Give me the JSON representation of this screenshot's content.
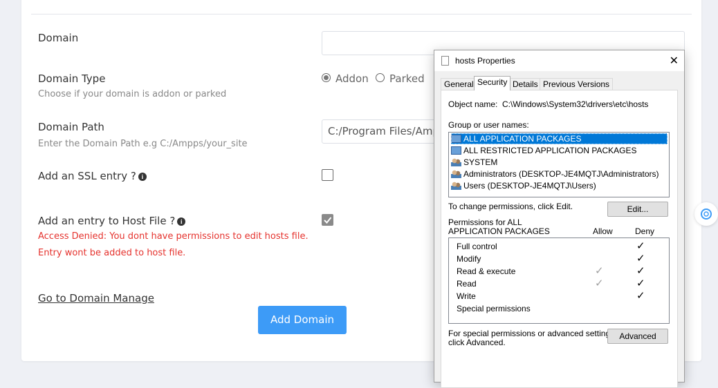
{
  "form": {
    "domain_label": "Domain",
    "domain_value": "",
    "domain_type_label": "Domain Type",
    "domain_type_hint": "Choose if your domain is addon or parked",
    "type_options": [
      "Addon",
      "Parked"
    ],
    "domain_path_label": "Domain Path",
    "domain_path_hint": "Enter the Domain Path e.g C:/Ampps/your_site",
    "domain_path_value": "C:/Program Files/Amp",
    "ssl_label": "Add an SSL entry ?",
    "hosts_label": "Add an entry to Host File ?",
    "error_1": "Access Denied: You dont have permissions to edit hosts file.",
    "error_2": "Entry wont be added to host file.",
    "manage_link": "Go to Domain Manage",
    "submit_label": "Add Domain",
    "info_glyph": "i"
  },
  "dialog": {
    "title": "hosts Properties",
    "close_glyph": "✕",
    "tabs": [
      "General",
      "Security",
      "Details",
      "Previous Versions"
    ],
    "object_name_label": "Object name:",
    "object_name_value": "C:\\Windows\\System32\\drivers\\etc\\hosts",
    "groups_label": "Group or user names:",
    "groups": [
      "ALL APPLICATION PACKAGES",
      "ALL RESTRICTED APPLICATION PACKAGES",
      "SYSTEM",
      "Administrators (DESKTOP-JE4MQTJ\\Administrators)",
      "Users (DESKTOP-JE4MQTJ\\Users)"
    ],
    "change_text": "To change permissions, click Edit.",
    "edit_button": "Edit...",
    "perm_for_line1": "Permissions for ALL",
    "perm_for_line2": "APPLICATION PACKAGES",
    "allow_header": "Allow",
    "deny_header": "Deny",
    "permissions": [
      "Full control",
      "Modify",
      "Read & execute",
      "Read",
      "Write",
      "Special permissions"
    ],
    "special_text_1": "For special permissions or advanced settings,",
    "special_text_2": "click Advanced.",
    "advanced_button": "Advanced",
    "check_glyph": "✓"
  },
  "colors": {
    "accent": "#3d9bf7",
    "error": "#e5322d",
    "selection": "#0078d7"
  }
}
